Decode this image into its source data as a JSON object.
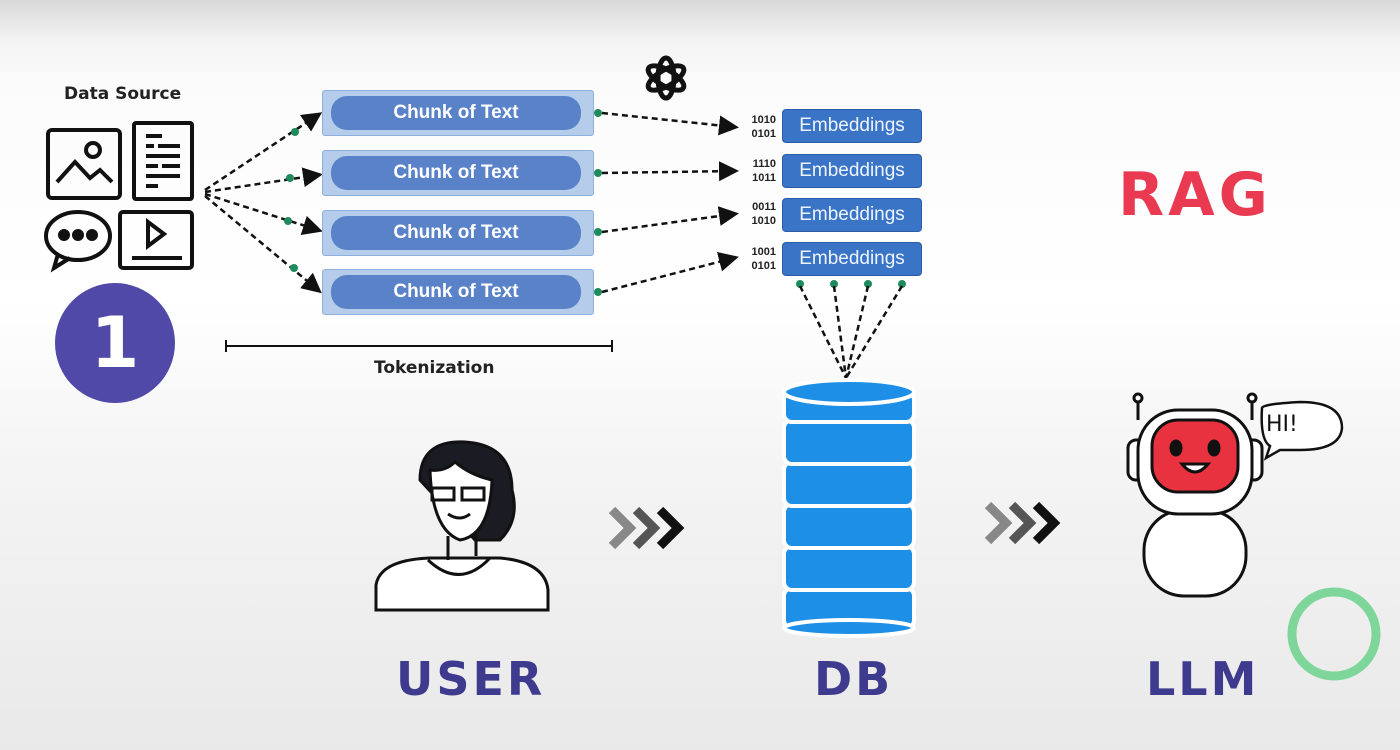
{
  "data_source": {
    "title": "Data Source",
    "icons": [
      "image-icon",
      "document-icon",
      "chat-bubble-icon",
      "video-icon"
    ]
  },
  "step_number": "1",
  "chunks": [
    "Chunk of Text",
    "Chunk of Text",
    "Chunk of Text",
    "Chunk of Text"
  ],
  "tokenization_label": "Tokenization",
  "embeddings": [
    {
      "label": "Embeddings",
      "bits": [
        "1010",
        "0101"
      ]
    },
    {
      "label": "Embeddings",
      "bits": [
        "1110",
        "1011"
      ]
    },
    {
      "label": "Embeddings",
      "bits": [
        "0011",
        "1010"
      ]
    },
    {
      "label": "Embeddings",
      "bits": [
        "1001",
        "0101"
      ]
    }
  ],
  "title": "RAG",
  "speech_bubble": "HI!",
  "labels": {
    "user": "USER",
    "db": "DB",
    "llm": "LLM"
  },
  "colors": {
    "chunk": "#5a82c9",
    "embedding": "#3a74c6",
    "database": "#1e8fe6",
    "rag": "#e93a52",
    "label": "#3e3a8e",
    "step_circle": "#5049a8",
    "robot_face": "#e8323f",
    "connector_dot": "#1f8a5c"
  }
}
